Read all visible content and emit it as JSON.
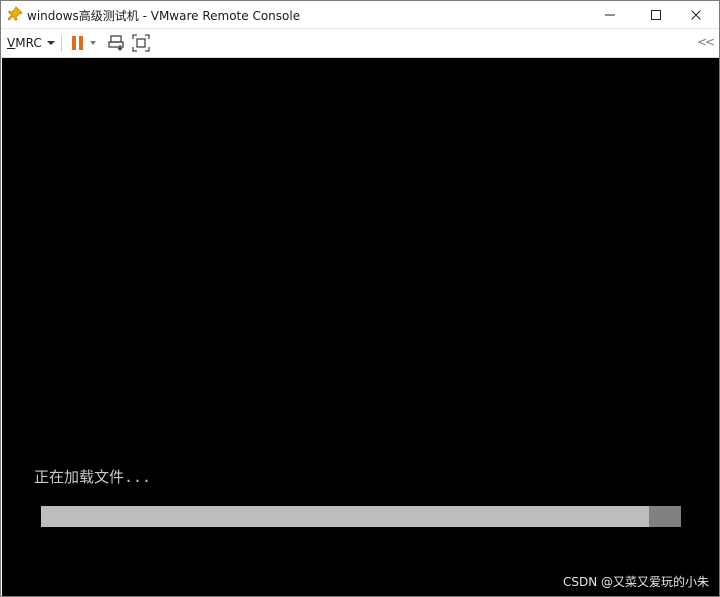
{
  "window": {
    "title": "windows高级测试机 - VMware Remote Console",
    "app_icon": "pin-icon"
  },
  "title_controls": {
    "minimize_icon": "minimize-icon",
    "maximize_icon": "maximize-icon",
    "close_icon": "close-icon"
  },
  "toolbar": {
    "menu_label": "VMRC",
    "pause_icon": "pause-icon",
    "send_keys_icon": "send-ctrl-alt-del-icon",
    "fullscreen_icon": "fullscreen-icon",
    "collapse_label": "<<",
    "accent": "#e06c1c"
  },
  "console": {
    "loading_text": "正在加载文件...",
    "progress": 0.95,
    "watermark": "CSDN @又菜又爱玩的小朱"
  }
}
